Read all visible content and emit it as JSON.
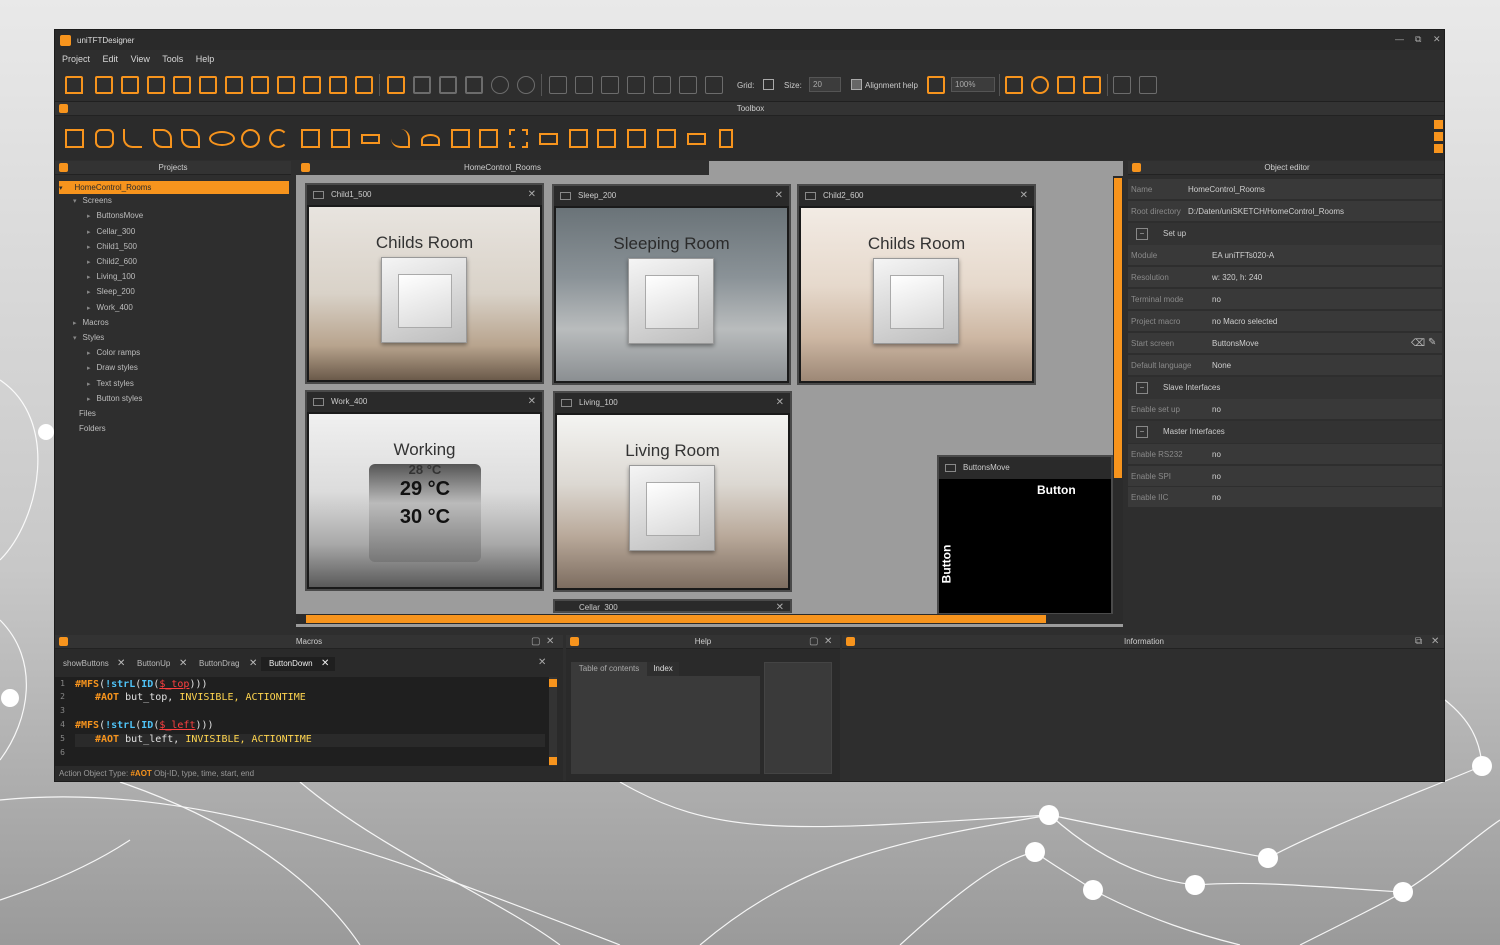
{
  "app": {
    "title": "uniTFTDesigner",
    "window_controls": [
      "—",
      "⧉",
      "✕"
    ]
  },
  "menu": [
    "Project",
    "Edit",
    "View",
    "Tools",
    "Help"
  ],
  "toolbar": {
    "grid_label": "Grid:",
    "size_label": "Size:",
    "size_value": "20",
    "alignment_label": "Alignment help",
    "zoom_value": "100%"
  },
  "toolbox": {
    "title": "Toolbox"
  },
  "projects": {
    "title": "Projects",
    "tree": [
      {
        "label": "HomeControl_Rooms",
        "level": 0,
        "selected": true,
        "arrow": "▾"
      },
      {
        "label": "Screens",
        "level": 1,
        "arrow": "▾"
      },
      {
        "label": "ButtonsMove",
        "level": 2,
        "arrow": "▸"
      },
      {
        "label": "Cellar_300",
        "level": 2,
        "arrow": "▸"
      },
      {
        "label": "Child1_500",
        "level": 2,
        "arrow": "▸"
      },
      {
        "label": "Child2_600",
        "level": 2,
        "arrow": "▸"
      },
      {
        "label": "Living_100",
        "level": 2,
        "arrow": "▸"
      },
      {
        "label": "Sleep_200",
        "level": 2,
        "arrow": "▸"
      },
      {
        "label": "Work_400",
        "level": 2,
        "arrow": "▸"
      },
      {
        "label": "Macros",
        "level": 1,
        "arrow": "▸"
      },
      {
        "label": "Styles",
        "level": 1,
        "arrow": "▾"
      },
      {
        "label": "Color ramps",
        "level": 2,
        "arrow": "▸"
      },
      {
        "label": "Draw styles",
        "level": 2,
        "arrow": "▸"
      },
      {
        "label": "Text styles",
        "level": 2,
        "arrow": "▸"
      },
      {
        "label": "Button styles",
        "level": 2,
        "arrow": "▸"
      },
      {
        "label": "Files",
        "level": 1,
        "arrow": ""
      },
      {
        "label": "Folders",
        "level": 1,
        "arrow": ""
      }
    ]
  },
  "canvas": {
    "tab_title": "HomeControl_Rooms",
    "screens": [
      {
        "name": "Child1_500",
        "label": "Childs Room"
      },
      {
        "name": "Sleep_200",
        "label": "Sleeping Room"
      },
      {
        "name": "Child2_600",
        "label": "Childs Room"
      },
      {
        "name": "Work_400",
        "label": "Working",
        "temps": [
          "28 °C",
          "29 °C",
          "30 °C"
        ]
      },
      {
        "name": "Living_100",
        "label": "Living Room"
      },
      {
        "name": "Cellar_300"
      }
    ],
    "buttons_move": {
      "name": "ButtonsMove",
      "button_h": "Button",
      "button_v": "Button"
    }
  },
  "object_editor": {
    "title": "Object editor",
    "rows": [
      {
        "type": "prop",
        "key": "Name",
        "value": "HomeControl_Rooms"
      },
      {
        "type": "prop",
        "key": "Root directory",
        "value": "D:/Daten/uniSKETCH/HomeControl_Rooms"
      },
      {
        "type": "group",
        "key": "Set up"
      },
      {
        "type": "prop",
        "key": "Module",
        "value": "EA uniTFTs020-A"
      },
      {
        "type": "prop",
        "key": "Resolution",
        "value": "w: 320,  h: 240"
      },
      {
        "type": "prop",
        "key": "Terminal mode",
        "value": "no"
      },
      {
        "type": "prop",
        "key": "Project macro",
        "value": "no Macro selected"
      },
      {
        "type": "prop",
        "key": "Start screen",
        "value": "ButtonsMove"
      },
      {
        "type": "prop",
        "key": "Default language",
        "value": "None"
      },
      {
        "type": "group",
        "key": "Slave Interfaces"
      },
      {
        "type": "prop",
        "key": "Enable set up",
        "value": "no"
      },
      {
        "type": "group",
        "key": "Master Interfaces"
      },
      {
        "type": "prop",
        "key": "Enable RS232",
        "value": "no"
      },
      {
        "type": "prop",
        "key": "Enable SPI",
        "value": "no"
      },
      {
        "type": "prop",
        "key": "Enable IIC",
        "value": "no"
      }
    ]
  },
  "macros": {
    "title": "Macros",
    "tabs": [
      "showButtons",
      "ButtonUp",
      "ButtonDrag",
      "ButtonDown"
    ],
    "line_numbers": [
      "1",
      "2",
      "3",
      "4",
      "5",
      "6"
    ],
    "code": {
      "l1": {
        "a": "#MFS",
        "b": "(",
        "c": "!strL",
        "d": "(",
        "e": "ID",
        "f": "(",
        "g": "$_top",
        "h": ")))"
      },
      "l2": {
        "a": "#AOT",
        "b": " but_top, ",
        "c": "INVISIBLE, ACTIONTIME"
      },
      "l4": {
        "a": "#MFS",
        "b": "(",
        "c": "!strL",
        "d": "(",
        "e": "ID",
        "f": "(",
        "g": "$_left",
        "h": ")))"
      },
      "l5": {
        "a": "#AOT",
        "b": " but_left, ",
        "c": "INVISIBLE, ACTIONTIME"
      }
    },
    "status_prefix": "Action Object Type:",
    "status_kw": "#AOT",
    "status_rest": "Obj-ID, type, time, start, end"
  },
  "help": {
    "title": "Help",
    "tabs": [
      "Table of contents",
      "Index"
    ]
  },
  "information": {
    "title": "Information"
  },
  "colors": {
    "accent": "#f7941d",
    "panel": "#2e2e2e",
    "canvas": "#9c9c9c"
  }
}
